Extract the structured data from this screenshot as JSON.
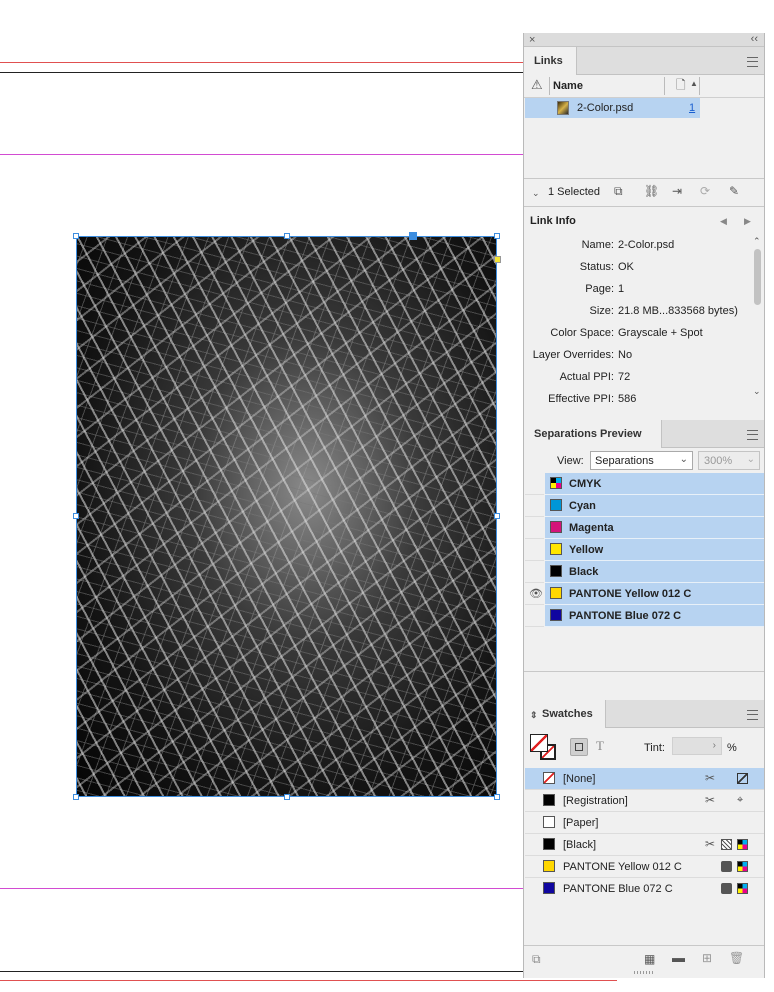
{
  "document": {
    "image_alt": "Black and white palm fronds image"
  },
  "links_panel": {
    "tab_label": "Links",
    "column_name": "Name",
    "items": [
      {
        "name": "2-Color.psd",
        "page": "1"
      }
    ],
    "selected_text": "1 Selected",
    "link_info_title": "Link Info",
    "info": [
      {
        "label": "Name:",
        "value": "2-Color.psd"
      },
      {
        "label": "Status:",
        "value": "OK"
      },
      {
        "label": "Page:",
        "value": "1"
      },
      {
        "label": "Size:",
        "value": "21.8 MB...833568 bytes)"
      },
      {
        "label": "Color Space:",
        "value": "Grayscale + Spot"
      },
      {
        "label": "Layer Overrides:",
        "value": "No"
      },
      {
        "label": "Actual PPI:",
        "value": "72"
      },
      {
        "label": "Effective PPI:",
        "value": "586"
      }
    ]
  },
  "separations_panel": {
    "tab_label": "Separations Preview",
    "view_label": "View:",
    "view_value": "Separations",
    "zoom_value": "300%",
    "rows": [
      {
        "name": "CMYK",
        "color": "cmyk",
        "visible": false
      },
      {
        "name": "Cyan",
        "color": "#0096d8",
        "visible": false
      },
      {
        "name": "Magenta",
        "color": "#d4147a",
        "visible": false
      },
      {
        "name": "Yellow",
        "color": "#ffe600",
        "visible": false
      },
      {
        "name": "Black",
        "color": "#000000",
        "visible": false
      },
      {
        "name": "PANTONE Yellow 012 C",
        "color": "#ffd700",
        "visible": true
      },
      {
        "name": "PANTONE Blue 072 C",
        "color": "#10069f",
        "visible": false
      }
    ]
  },
  "swatches_panel": {
    "tab_label": "Swatches",
    "tint_label": "Tint:",
    "tint_value": "",
    "tint_unit": "%",
    "swatches": [
      {
        "name": "[None]",
        "color": "none"
      },
      {
        "name": "[Registration]",
        "color": "#000000"
      },
      {
        "name": "[Paper]",
        "color": "#ffffff"
      },
      {
        "name": "[Black]",
        "color": "#000000"
      },
      {
        "name": "PANTONE Yellow 012 C",
        "color": "#ffd700"
      },
      {
        "name": "PANTONE Blue 072 C",
        "color": "#10069f"
      }
    ]
  },
  "colors": {
    "selection": "#b7d3f1",
    "frame_blue": "#3d8ee0",
    "guide_magenta": "#d24bd2",
    "bleed_red": "#e05050"
  }
}
